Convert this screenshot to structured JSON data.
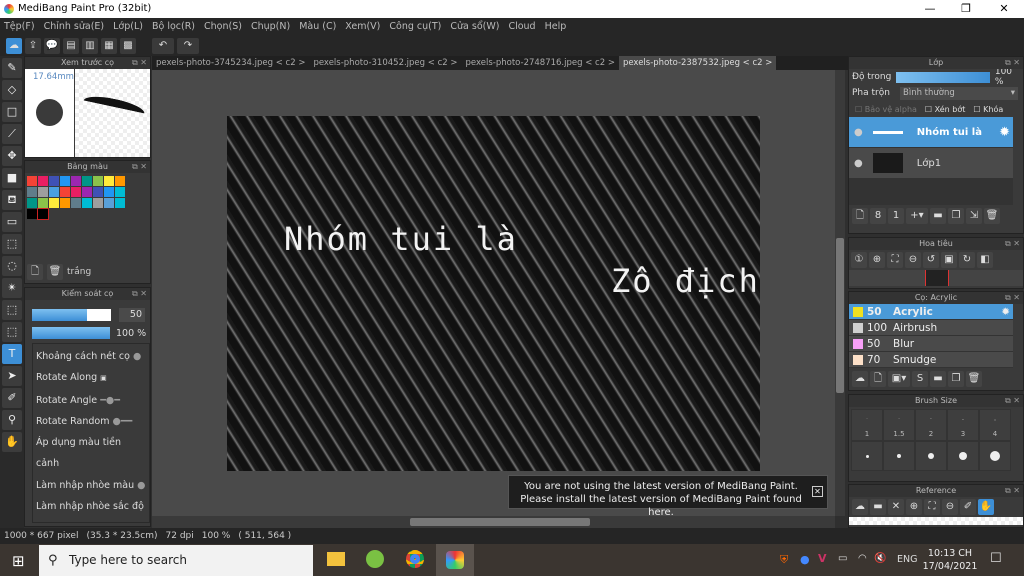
{
  "window": {
    "title": "MediBang Paint Pro (32bit)",
    "minimize": "—",
    "maximize": "❐",
    "close": "✕"
  },
  "menu": [
    "Tệp(F)",
    "Chỉnh sửa(E)",
    "Lớp(L)",
    "Bộ lọc(R)",
    "Chọn(S)",
    "Chụp(N)",
    "Màu (C)",
    "Xem(V)",
    "Công cụ(T)",
    "Cửa sổ(W)",
    "Cloud",
    "Help"
  ],
  "tabs": [
    "pexels-photo-3745234.jpeg < c2 >",
    "pexels-photo-310452.jpeg < c2 >",
    "pexels-photo-2748716.jpeg < c2 >",
    "pexels-photo-2387532.jpeg < c2 >"
  ],
  "brush_preview": {
    "title": "Xem trước cọ",
    "size": "17.64mm"
  },
  "palette": {
    "title": "Bảng màu",
    "name": "trắng",
    "colors": [
      "#f44336",
      "#e91e63",
      "#3f51b5",
      "#2196f3",
      "#9c27b0",
      "#009688",
      "#8bc34a",
      "#ffeb3b",
      "#ff9800",
      "#607d8b",
      "#9e9e9e",
      "#4aa0e0",
      "#f44336",
      "#e91e63",
      "#9c27b0",
      "#3f51b5",
      "#2196f3",
      "#00bcd4",
      "#009688",
      "#8bc34a",
      "#ffeb3b",
      "#ff9800",
      "#607d8b",
      "#00bcd4",
      "#9e9e9e",
      "#5aa0d8",
      "#00bcd4",
      "#000000",
      "#000000"
    ]
  },
  "brush_control": {
    "title": "Kiểm soát cọ",
    "size_value": "50",
    "size_fraction": 0.7,
    "opacity": "100 %",
    "options": [
      "Khoảng cách nét cọ",
      "Rotate Along",
      "Rotate Angle",
      "Rotate Random",
      "Áp dụng màu tiền cảnh",
      "Làm nhập nhòe màu",
      "Làm nhập nhòe sắc độ"
    ]
  },
  "canvas": {
    "text1": "Nhóm tui là",
    "text2": "Zô địch"
  },
  "notice": {
    "line1": "You are not using the latest version of MediBang Paint.",
    "line2": "Please install the latest version of MediBang Paint found here.",
    "close": "✕"
  },
  "status": {
    "size": "1000 * 667 pixel",
    "cm": "(35.3 * 23.5cm)",
    "dpi": "72 dpi",
    "zoom": "100 %",
    "coords": "( 511, 564 )"
  },
  "layers": {
    "title": "Lớp",
    "opacity_label": "Độ trong",
    "opacity": "100 %",
    "blend_label": "Pha trộn",
    "blend": "Bình thường",
    "protect_alpha": "Bảo vệ alpha",
    "clip": "Xén bớt",
    "lock": "Khóa",
    "items": [
      {
        "name": "Nhóm tui là",
        "selected": true
      },
      {
        "name": "Lớp1",
        "selected": false
      }
    ]
  },
  "navigator": {
    "title": "Hoa tiêu"
  },
  "brushes": {
    "title": "Cọ: Acrylic",
    "items": [
      {
        "size": "50",
        "name": "Acrylic",
        "color": "#f0e020"
      },
      {
        "size": "100",
        "name": "Airbrush",
        "color": "#d0d0d0"
      },
      {
        "size": "50",
        "name": "Blur",
        "color": "#f8a0f8"
      },
      {
        "size": "70",
        "name": "Smudge",
        "color": "#fde0c8"
      }
    ]
  },
  "brush_size": {
    "title": "Brush Size",
    "sizes": [
      "1",
      "1.5",
      "2",
      "3",
      "4"
    ]
  },
  "reference": {
    "title": "Reference"
  },
  "taskbar": {
    "search_placeholder": "Type here to search",
    "time": "10:13 CH",
    "date": "17/04/2021",
    "lang": "ENG"
  },
  "colors": {
    "accent": "#3d8fd6",
    "panel": "#3a3a3a"
  }
}
